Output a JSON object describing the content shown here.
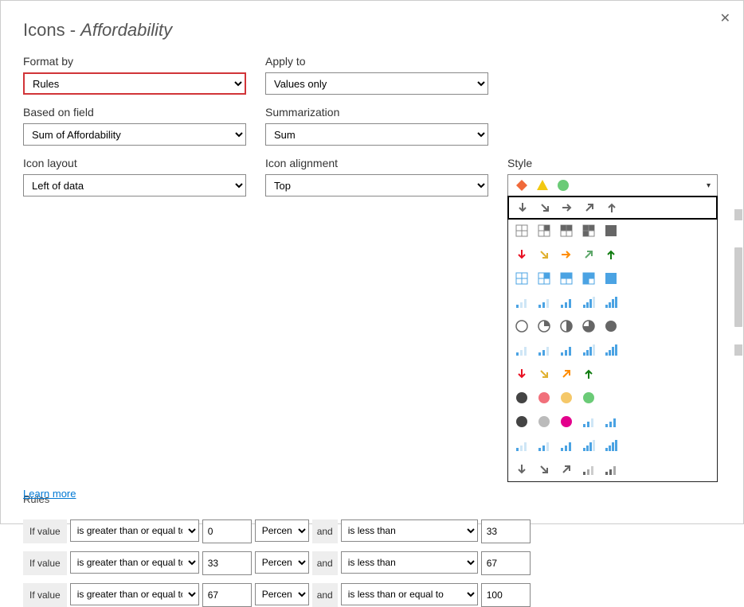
{
  "dialog": {
    "title_prefix": "Icons -",
    "title_subject": "Affordability",
    "close_label": "✕"
  },
  "formatBy": {
    "label": "Format by",
    "value": "Rules"
  },
  "applyTo": {
    "label": "Apply to",
    "value": "Values only"
  },
  "basedOn": {
    "label": "Based on field",
    "value": "Sum of Affordability"
  },
  "summarization": {
    "label": "Summarization",
    "value": "Sum"
  },
  "iconLayout": {
    "label": "Icon layout",
    "value": "Left of data"
  },
  "iconAlignment": {
    "label": "Icon alignment",
    "value": "Top"
  },
  "style": {
    "label": "Style"
  },
  "rules": {
    "label": "Rules",
    "ifValue": "If value",
    "and": "and",
    "rows": [
      {
        "op1": "is greater than or equal to",
        "val1": "0",
        "unit": "Percent",
        "op2": "is less than",
        "val2": "33"
      },
      {
        "op1": "is greater than or equal to",
        "val1": "33",
        "unit": "Percent",
        "op2": "is less than",
        "val2": "67"
      },
      {
        "op1": "is greater than or equal to",
        "val1": "67",
        "unit": "Percent",
        "op2": "is less than or equal to",
        "val2": "100"
      }
    ]
  },
  "styleOptions": {
    "header": "diamond-triangle-circle",
    "selected_index": 0,
    "rows": [
      "arrows-gray-5",
      "quadrants-gray",
      "arrows-colored-5",
      "quadrants-blue",
      "bars-blue-a",
      "pies-gray",
      "bars-blue-b",
      "arrows-colored-5b",
      "dots-4colored",
      "dots-3gray-bars",
      "bars-blue-c",
      "arrows-gray-bars"
    ]
  },
  "learnMore": "Learn more",
  "colors": {
    "red": "#e81123",
    "yellow": "#f2c811",
    "green": "#107c10",
    "orange": "#ff8c00",
    "gray": "#666666",
    "darkgray": "#444444",
    "blue": "#4ba3e3",
    "magenta": "#e3008c",
    "coral": "#f1707b",
    "amber": "#f5c869",
    "mint": "#6bcb77",
    "silver": "#bbbbbb"
  }
}
